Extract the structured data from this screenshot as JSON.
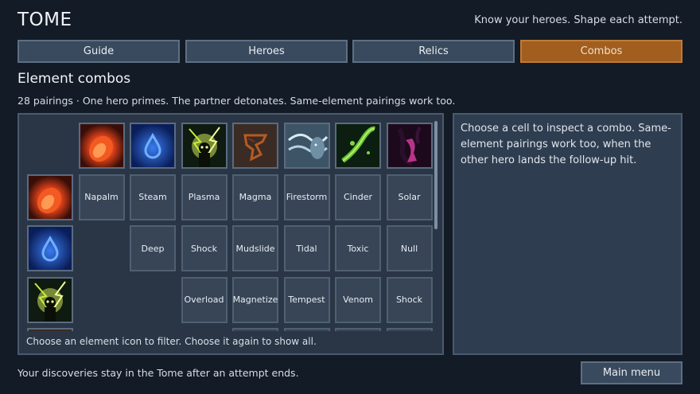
{
  "app": {
    "title": "TOME",
    "tagline": "Know your heroes. Shape each attempt."
  },
  "tabs": [
    {
      "label": "Guide",
      "active": false
    },
    {
      "label": "Heroes",
      "active": false
    },
    {
      "label": "Relics",
      "active": false
    },
    {
      "label": "Combos",
      "active": true
    }
  ],
  "section": {
    "title": "Element combos",
    "subtitle": "28 pairings · One hero primes. The partner detonates. Same-element pairings work too."
  },
  "elements": [
    {
      "icon": "fire-icon",
      "color": "#e8451c"
    },
    {
      "icon": "water-icon",
      "color": "#2a6ee8"
    },
    {
      "icon": "lightning-icon",
      "color": "#c8f03a"
    },
    {
      "icon": "earth-icon",
      "color": "#b65a24"
    },
    {
      "icon": "wind-icon",
      "color": "#9fc0d4"
    },
    {
      "icon": "poison-icon",
      "color": "#66c22e"
    },
    {
      "icon": "void-icon",
      "color": "#b8338a"
    }
  ],
  "combo_rows": [
    [
      "Napalm",
      "Steam",
      "Plasma",
      "Magma",
      "Firestorm",
      "Cinder",
      "Solar"
    ],
    [
      "",
      "Deep",
      "Shock",
      "Mudslide",
      "Tidal",
      "Toxic",
      "Null"
    ],
    [
      "",
      "",
      "Overload",
      "Magnetize",
      "Tempest",
      "Venom",
      "Shock"
    ]
  ],
  "grid_hint": "Choose an element icon to filter. Choose it again to show all.",
  "info_panel": {
    "text": "Choose a cell to inspect a combo. Same-element pairings work too, when the other hero lands the follow-up hit."
  },
  "footer": {
    "note": "Your discoveries stay in the Tome after an attempt ends.",
    "main_menu_label": "Main menu"
  },
  "colors": {
    "background": "#131b26",
    "panel": "#2a3646",
    "active_tab": "#a15e1f"
  }
}
